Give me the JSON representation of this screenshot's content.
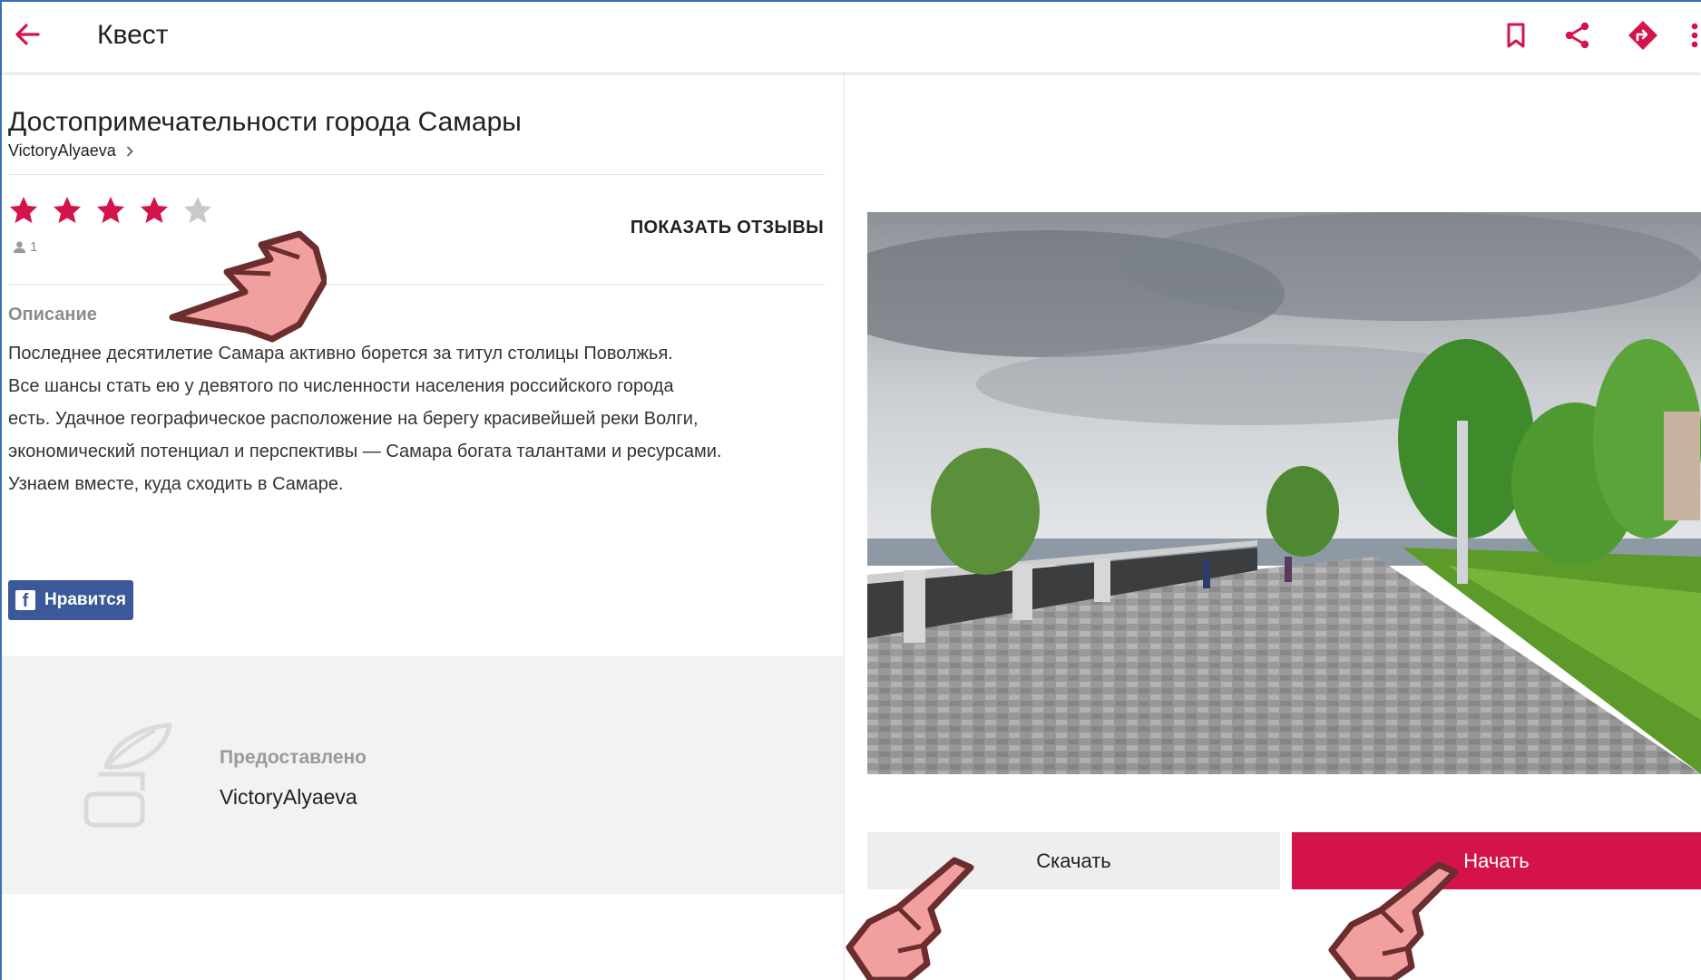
{
  "appbar": {
    "title": "Квест",
    "icons": [
      "back-arrow-icon",
      "bookmark-icon",
      "share-icon",
      "directions-icon",
      "more-vert-icon"
    ]
  },
  "quest": {
    "title": "Достопримечательности города Самары",
    "author": "VictoryAlyaeva",
    "rating": 4,
    "rating_max": 5,
    "reviews_count": "1",
    "show_reviews_label": "ПОКАЗАТЬ ОТЗЫВЫ",
    "description_label": "Описание",
    "description_lines": [
      "Последнее десятилетие Самара активно борется за титул столицы Поволжья.",
      "Все шансы стать ею у девятого по численности населения российского города",
      "есть. Удачное географическое расположение на берегу красивейшей реки Волги,",
      "экономический потенциал и перспективы — Самара богата талантами и ресурсами.",
      "Узнаем вместе, куда сходить в Самаре."
    ],
    "like_label": "Нравится"
  },
  "provided": {
    "label": "Предоставлено",
    "name": "VictoryAlyaeva"
  },
  "actions": {
    "download_label": "Скачать",
    "start_label": "Начать"
  },
  "colors": {
    "accent": "#d4134a",
    "star_filled": "#d4134a",
    "star_empty": "#c9c9c9",
    "facebook": "#3b5998",
    "hand_fill": "#f29f9f",
    "hand_outline": "#6b2d2d"
  }
}
